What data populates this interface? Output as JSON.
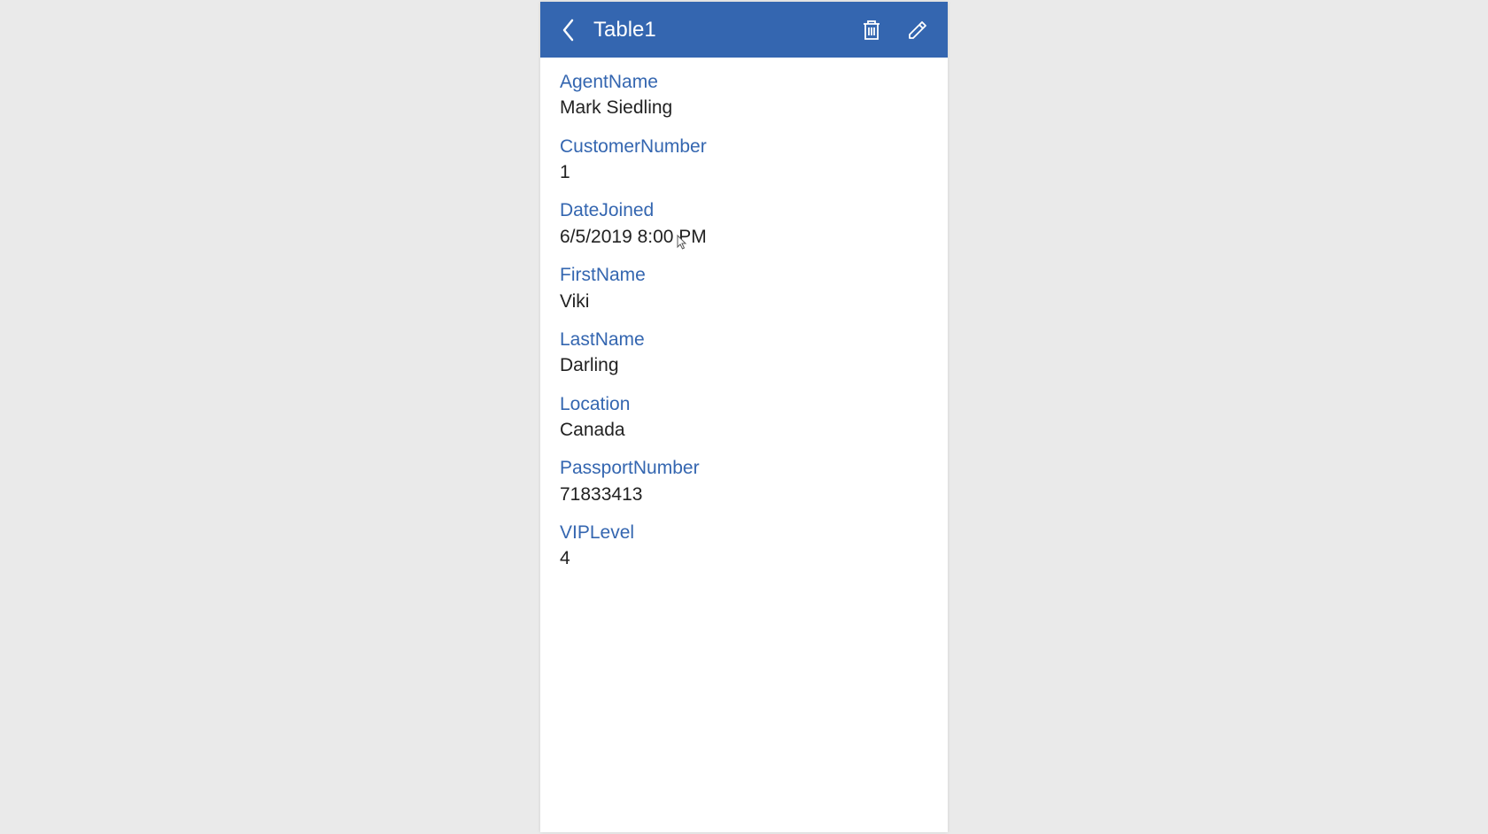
{
  "header": {
    "title": "Table1"
  },
  "fields": [
    {
      "label": "AgentName",
      "value": "Mark Siedling"
    },
    {
      "label": "CustomerNumber",
      "value": "1"
    },
    {
      "label": "DateJoined",
      "value": "6/5/2019 8:00 PM"
    },
    {
      "label": "FirstName",
      "value": "Viki"
    },
    {
      "label": "LastName",
      "value": "Darling"
    },
    {
      "label": "Location",
      "value": "Canada"
    },
    {
      "label": "PassportNumber",
      "value": "71833413"
    },
    {
      "label": "VIPLevel",
      "value": "4"
    }
  ]
}
